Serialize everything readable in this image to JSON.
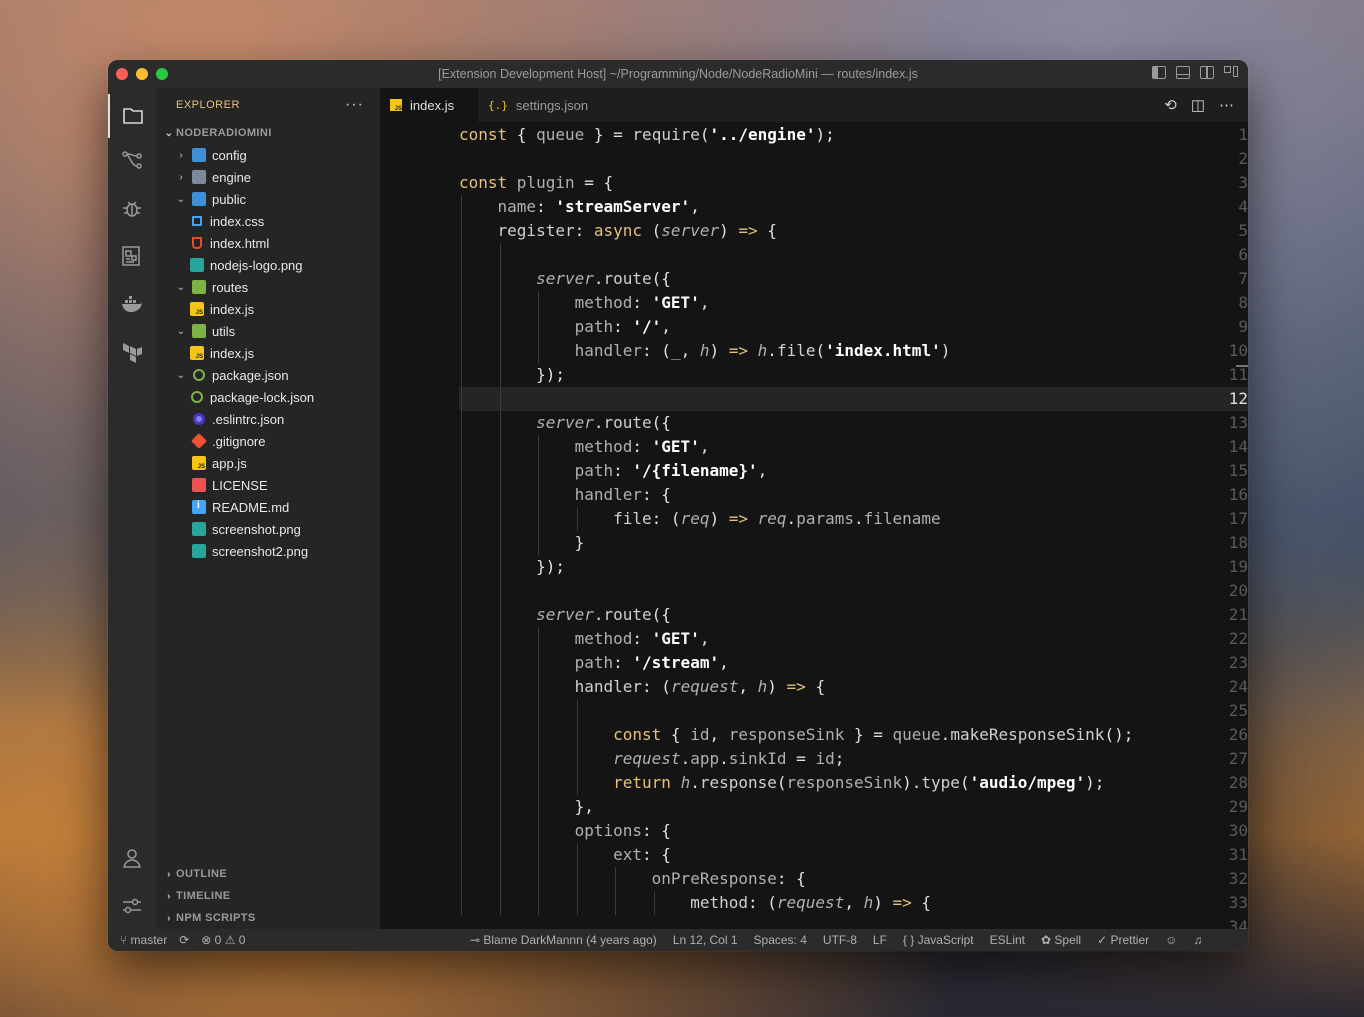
{
  "window": {
    "title": "[Extension Development Host] ~/Programming/Node/NodeRadioMini — routes/index.js"
  },
  "sidebar": {
    "title": "EXPLORER",
    "more": "···",
    "project": "NODERADIOMINI",
    "tree": [
      {
        "label": "config",
        "chevron": "›",
        "icon": "folder-config-icon",
        "depth": 0
      },
      {
        "label": "engine",
        "chevron": "›",
        "icon": "folder-icon",
        "depth": 0
      },
      {
        "label": "public",
        "chevron": "⌄",
        "icon": "folder-public-icon",
        "depth": 0
      },
      {
        "label": "index.css",
        "chevron": "",
        "icon": "css-file-icon",
        "depth": 1
      },
      {
        "label": "index.html",
        "chevron": "",
        "icon": "html-file-icon",
        "depth": 1
      },
      {
        "label": "nodejs-logo.png",
        "chevron": "",
        "icon": "image-file-icon",
        "depth": 1
      },
      {
        "label": "routes",
        "chevron": "⌄",
        "icon": "folder-routes-icon",
        "depth": 0
      },
      {
        "label": "index.js",
        "chevron": "",
        "icon": "js-file-icon",
        "depth": 1
      },
      {
        "label": "utils",
        "chevron": "⌄",
        "icon": "folder-utils-icon",
        "depth": 0
      },
      {
        "label": "index.js",
        "chevron": "",
        "icon": "js-file-icon",
        "depth": 1
      },
      {
        "label": "package.json",
        "chevron": "⌄",
        "icon": "npm-icon",
        "depth": 0
      },
      {
        "label": "package-lock.json",
        "chevron": "",
        "icon": "npm-icon",
        "depth": 1
      },
      {
        "label": ".eslintrc.json",
        "chevron": "",
        "icon": "eslint-icon",
        "depth": 0
      },
      {
        "label": ".gitignore",
        "chevron": "",
        "icon": "git-icon",
        "depth": 0
      },
      {
        "label": "app.js",
        "chevron": "",
        "icon": "js-file-icon",
        "depth": 0
      },
      {
        "label": "LICENSE",
        "chevron": "",
        "icon": "license-icon",
        "depth": 0
      },
      {
        "label": "README.md",
        "chevron": "",
        "icon": "info-icon",
        "depth": 0
      },
      {
        "label": "screenshot.png",
        "chevron": "",
        "icon": "image-file-icon",
        "depth": 0
      },
      {
        "label": "screenshot2.png",
        "chevron": "",
        "icon": "image-file-icon",
        "depth": 0
      }
    ],
    "sections": [
      "OUTLINE",
      "TIMELINE",
      "NPM SCRIPTS"
    ]
  },
  "tabs": [
    {
      "label": "index.js",
      "active": true
    },
    {
      "label": "settings.json",
      "active": false
    }
  ],
  "editor": {
    "current_line": 12,
    "lines": [
      [
        [
          "kw",
          "const"
        ],
        [
          "pun",
          " { "
        ],
        [
          "id",
          "queue"
        ],
        [
          "pun",
          " } = "
        ],
        [
          "fn",
          "require"
        ],
        [
          "pun",
          "("
        ],
        [
          "str",
          "'../engine'"
        ],
        [
          "pun",
          ");"
        ]
      ],
      [],
      [
        [
          "kw",
          "const"
        ],
        [
          "id",
          " plugin"
        ],
        [
          "pun",
          " = {"
        ]
      ],
      [
        [
          "pun",
          "    "
        ],
        [
          "pr",
          "name"
        ],
        [
          "pun",
          ": "
        ],
        [
          "str",
          "'streamServer'"
        ],
        [
          "pun",
          ","
        ]
      ],
      [
        [
          "pun",
          "    "
        ],
        [
          "fn",
          "register"
        ],
        [
          "pun",
          ": "
        ],
        [
          "kw",
          "async"
        ],
        [
          "pun",
          " ("
        ],
        [
          "it",
          "server"
        ],
        [
          "pun",
          ") "
        ],
        [
          "ar",
          "=>"
        ],
        [
          "pun",
          " {"
        ]
      ],
      [],
      [
        [
          "pun",
          "        "
        ],
        [
          "it",
          "server"
        ],
        [
          "pun",
          "."
        ],
        [
          "fn",
          "route"
        ],
        [
          "pun",
          "({"
        ]
      ],
      [
        [
          "pun",
          "            "
        ],
        [
          "pr",
          "method"
        ],
        [
          "pun",
          ": "
        ],
        [
          "str",
          "'GET'"
        ],
        [
          "pun",
          ","
        ]
      ],
      [
        [
          "pun",
          "            "
        ],
        [
          "pr",
          "path"
        ],
        [
          "pun",
          ": "
        ],
        [
          "str",
          "'/'"
        ],
        [
          "pun",
          ","
        ]
      ],
      [
        [
          "pun",
          "            "
        ],
        [
          "pr",
          "handler"
        ],
        [
          "pun",
          ": ("
        ],
        [
          "id",
          "_"
        ],
        [
          "pun",
          ", "
        ],
        [
          "it",
          "h"
        ],
        [
          "pun",
          ") "
        ],
        [
          "ar",
          "=>"
        ],
        [
          "pun",
          " "
        ],
        [
          "it",
          "h"
        ],
        [
          "pun",
          "."
        ],
        [
          "fn",
          "file"
        ],
        [
          "pun",
          "("
        ],
        [
          "str",
          "'index.html'"
        ],
        [
          "pun",
          ")"
        ]
      ],
      [
        [
          "pun",
          "        });"
        ]
      ],
      [],
      [
        [
          "pun",
          "        "
        ],
        [
          "it",
          "server"
        ],
        [
          "pun",
          "."
        ],
        [
          "fn",
          "route"
        ],
        [
          "pun",
          "({"
        ]
      ],
      [
        [
          "pun",
          "            "
        ],
        [
          "pr",
          "method"
        ],
        [
          "pun",
          ": "
        ],
        [
          "str",
          "'GET'"
        ],
        [
          "pun",
          ","
        ]
      ],
      [
        [
          "pun",
          "            "
        ],
        [
          "pr",
          "path"
        ],
        [
          "pun",
          ": "
        ],
        [
          "str",
          "'/{filename}'"
        ],
        [
          "pun",
          ","
        ]
      ],
      [
        [
          "pun",
          "            "
        ],
        [
          "pr",
          "handler"
        ],
        [
          "pun",
          ": {"
        ]
      ],
      [
        [
          "pun",
          "                "
        ],
        [
          "fn",
          "file"
        ],
        [
          "pun",
          ": ("
        ],
        [
          "it",
          "req"
        ],
        [
          "pun",
          ") "
        ],
        [
          "ar",
          "=>"
        ],
        [
          "pun",
          " "
        ],
        [
          "it",
          "req"
        ],
        [
          "pun",
          "."
        ],
        [
          "id",
          "params"
        ],
        [
          "pun",
          "."
        ],
        [
          "id",
          "filename"
        ]
      ],
      [
        [
          "pun",
          "            }"
        ]
      ],
      [
        [
          "pun",
          "        });"
        ]
      ],
      [],
      [
        [
          "pun",
          "        "
        ],
        [
          "it",
          "server"
        ],
        [
          "pun",
          "."
        ],
        [
          "fn",
          "route"
        ],
        [
          "pun",
          "({"
        ]
      ],
      [
        [
          "pun",
          "            "
        ],
        [
          "pr",
          "method"
        ],
        [
          "pun",
          ": "
        ],
        [
          "str",
          "'GET'"
        ],
        [
          "pun",
          ","
        ]
      ],
      [
        [
          "pun",
          "            "
        ],
        [
          "pr",
          "path"
        ],
        [
          "pun",
          ": "
        ],
        [
          "str",
          "'/stream'"
        ],
        [
          "pun",
          ","
        ]
      ],
      [
        [
          "pun",
          "            "
        ],
        [
          "fn",
          "handler"
        ],
        [
          "pun",
          ": ("
        ],
        [
          "it",
          "request"
        ],
        [
          "pun",
          ", "
        ],
        [
          "it",
          "h"
        ],
        [
          "pun",
          ") "
        ],
        [
          "ar",
          "=>"
        ],
        [
          "pun",
          " {"
        ]
      ],
      [],
      [
        [
          "pun",
          "                "
        ],
        [
          "kw",
          "const"
        ],
        [
          "pun",
          " { "
        ],
        [
          "id",
          "id"
        ],
        [
          "pun",
          ", "
        ],
        [
          "id",
          "responseSink"
        ],
        [
          "pun",
          " } = "
        ],
        [
          "id",
          "queue"
        ],
        [
          "pun",
          "."
        ],
        [
          "fn",
          "makeResponseSink"
        ],
        [
          "pun",
          "();"
        ]
      ],
      [
        [
          "pun",
          "                "
        ],
        [
          "it",
          "request"
        ],
        [
          "pun",
          "."
        ],
        [
          "id",
          "app"
        ],
        [
          "pun",
          "."
        ],
        [
          "id",
          "sinkId"
        ],
        [
          "pun",
          " = "
        ],
        [
          "id",
          "id"
        ],
        [
          "pun",
          ";"
        ]
      ],
      [
        [
          "pun",
          "                "
        ],
        [
          "kw",
          "return"
        ],
        [
          "pun",
          " "
        ],
        [
          "it",
          "h"
        ],
        [
          "pun",
          "."
        ],
        [
          "fn",
          "response"
        ],
        [
          "pun",
          "("
        ],
        [
          "id",
          "responseSink"
        ],
        [
          "pun",
          ")."
        ],
        [
          "fn",
          "type"
        ],
        [
          "pun",
          "("
        ],
        [
          "str",
          "'audio/mpeg'"
        ],
        [
          "pun",
          ");"
        ]
      ],
      [
        [
          "pun",
          "            },"
        ]
      ],
      [
        [
          "pun",
          "            "
        ],
        [
          "pr",
          "options"
        ],
        [
          "pun",
          ": {"
        ]
      ],
      [
        [
          "pun",
          "                "
        ],
        [
          "pr",
          "ext"
        ],
        [
          "pun",
          ": {"
        ]
      ],
      [
        [
          "pun",
          "                    "
        ],
        [
          "pr",
          "onPreResponse"
        ],
        [
          "pun",
          ": {"
        ]
      ],
      [
        [
          "pun",
          "                        "
        ],
        [
          "fn",
          "method"
        ],
        [
          "pun",
          ": ("
        ],
        [
          "it",
          "request"
        ],
        [
          "pun",
          ", "
        ],
        [
          "it",
          "h"
        ],
        [
          "pun",
          ") "
        ],
        [
          "ar",
          "=>"
        ],
        [
          "pun",
          " {"
        ]
      ],
      []
    ],
    "line_numbers": [
      "1",
      "2",
      "3",
      "4",
      "5",
      "6",
      "7",
      "8",
      "9",
      "10",
      "11",
      "12",
      "13",
      "14",
      "15",
      "16",
      "17",
      "18",
      "19",
      "20",
      "21",
      "22",
      "23",
      "24",
      "25",
      "26",
      "27",
      "28",
      "29",
      "30",
      "31",
      "32",
      "33",
      "34"
    ]
  },
  "status": {
    "branch": "master",
    "sync": "⟳",
    "problems": "⊗ 0 ⚠ 0",
    "blame": "Blame DarkMannn (4 years ago)",
    "position": "Ln 12, Col 1",
    "spaces": "Spaces: 4",
    "encoding": "UTF-8",
    "eol": "LF",
    "language": "{ } JavaScript",
    "eslint": "ESLint",
    "spell": "Spell",
    "prettier": "Prettier"
  },
  "colors": {
    "accent": "#e5c07b",
    "editor_bg": "#141414",
    "sidebar_bg": "#252526"
  }
}
